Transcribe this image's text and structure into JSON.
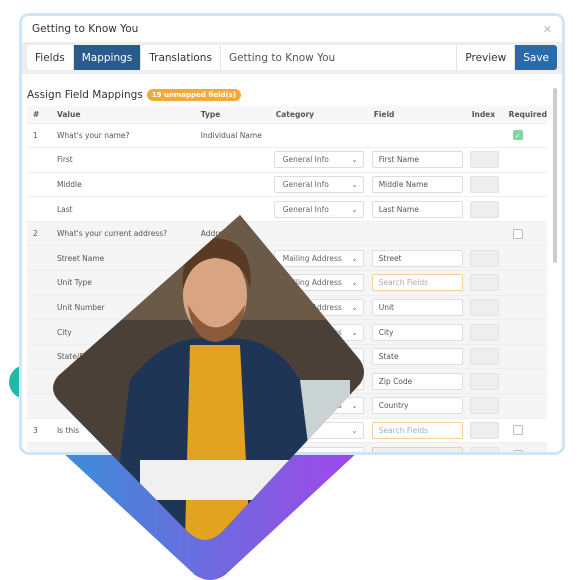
{
  "window": {
    "title": "Getting to Know You",
    "close_icon": "close-icon"
  },
  "tabs": [
    {
      "label": "Fields"
    },
    {
      "label": "Mappings",
      "active": true
    },
    {
      "label": "Translations"
    }
  ],
  "form_title": "Getting to Know You",
  "buttons": {
    "preview": "Preview",
    "save": "Save"
  },
  "section": {
    "title": "Assign Field Mappings",
    "badge": "19 unmapped field(s)"
  },
  "columns": [
    "#",
    "Value",
    "Type",
    "Category",
    "Field",
    "Index",
    "Required"
  ],
  "rows": [
    {
      "num": "1",
      "value": "What's your name?",
      "type": "Individual Name",
      "required": true
    },
    {
      "value": "First",
      "category": "General Info",
      "field": "First Name"
    },
    {
      "value": "Middle",
      "category": "General Info",
      "field": "Middle Name"
    },
    {
      "value": "Last",
      "category": "General Info",
      "field": "Last Name"
    },
    {
      "num": "2",
      "value": "What's your current address?",
      "type": "Address",
      "required": false
    },
    {
      "value": "Street Name",
      "category": "Mailing Address",
      "field": "Street"
    },
    {
      "value": "Unit Type",
      "category": "Mailing Address",
      "placeholder": "Search Fields"
    },
    {
      "value": "Unit Number",
      "category": "Mailing Address",
      "field": "Unit"
    },
    {
      "value": "City",
      "category": "Mailing Address",
      "field": "City"
    },
    {
      "value": "State/Pro",
      "category": "Mailing Address",
      "field": "State"
    },
    {
      "value": "",
      "category": "Mailing Address",
      "field": "Zip Code"
    },
    {
      "value": "",
      "category": "Mailing Address",
      "field": "Country"
    },
    {
      "num": "3",
      "value": "Is this",
      "category": "Field",
      "placeholder": "Search Fields",
      "required": false
    },
    {
      "num": "4",
      "value": "How long hav",
      "category": "Category...",
      "placeholder": "Search Fields",
      "disabled": true,
      "required": false
    }
  ],
  "colors": {
    "accent": "#2b5a8c",
    "save": "#2b6aa8",
    "badge": "#f2a93b",
    "check": "#7dd6a3",
    "frame": "#cfe6f8"
  }
}
